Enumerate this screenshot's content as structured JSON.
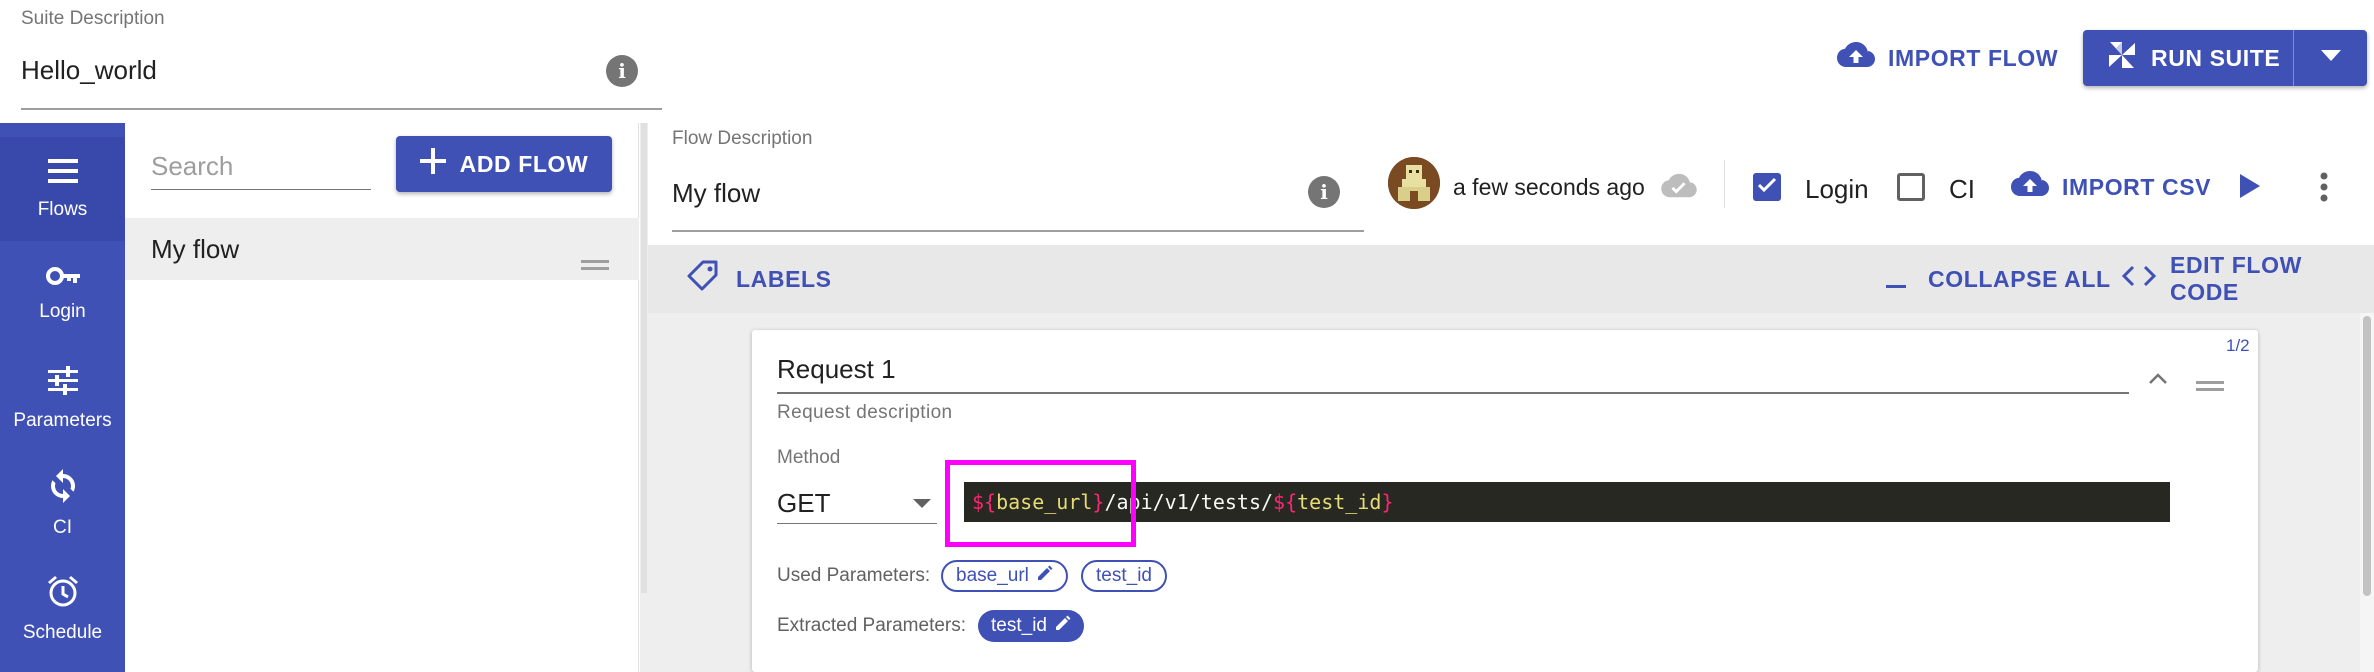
{
  "suite": {
    "description_label": "Suite Description",
    "description_value": "Hello_world",
    "import_flow_label": "IMPORT FLOW",
    "run_suite_label": "RUN SUITE"
  },
  "nav": {
    "items": [
      {
        "label": "Flows",
        "icon": "list-icon",
        "active": true
      },
      {
        "label": "Login",
        "icon": "key-icon"
      },
      {
        "label": "Parameters",
        "icon": "sliders-icon"
      },
      {
        "label": "CI",
        "icon": "sync-icon"
      },
      {
        "label": "Schedule",
        "icon": "alarm-clock-icon"
      }
    ]
  },
  "flows_panel": {
    "search_placeholder": "Search",
    "add_flow_label": "ADD FLOW",
    "items": [
      {
        "name": "My flow"
      }
    ]
  },
  "flow": {
    "description_label": "Flow Description",
    "description_value": "My flow",
    "updated_text": "a few seconds ago",
    "login_label": "Login",
    "login_checked": true,
    "ci_label": "CI",
    "ci_checked": false,
    "import_csv_label": "IMPORT CSV"
  },
  "toolbar": {
    "labels_label": "LABELS",
    "collapse_all_label": "COLLAPSE ALL",
    "edit_flow_code_label": "EDIT FLOW CODE"
  },
  "request": {
    "counter": "1/2",
    "title": "Request 1",
    "description_placeholder": "Request description",
    "method_label": "Method",
    "method_value": "GET",
    "url_tokens": [
      {
        "text": "${",
        "kind": "brace"
      },
      {
        "text": "base_url",
        "kind": "var"
      },
      {
        "text": "}",
        "kind": "brace"
      },
      {
        "text": "/api/v1/tests/",
        "kind": "plain"
      },
      {
        "text": "${",
        "kind": "brace"
      },
      {
        "text": "test_id",
        "kind": "var"
      },
      {
        "text": "}",
        "kind": "brace"
      }
    ],
    "used_params_label": "Used Parameters:",
    "used_params": [
      {
        "name": "base_url",
        "editable": true
      },
      {
        "name": "test_id",
        "editable": false
      }
    ],
    "extracted_params_label": "Extracted Parameters:",
    "extracted_params": [
      {
        "name": "test_id",
        "editable": true
      }
    ]
  },
  "colors": {
    "primary": "#3f51b5",
    "highlight": "#ff00ff",
    "editor_bg": "#272822",
    "token_brace": "#f92672",
    "token_var": "#e6db74"
  }
}
